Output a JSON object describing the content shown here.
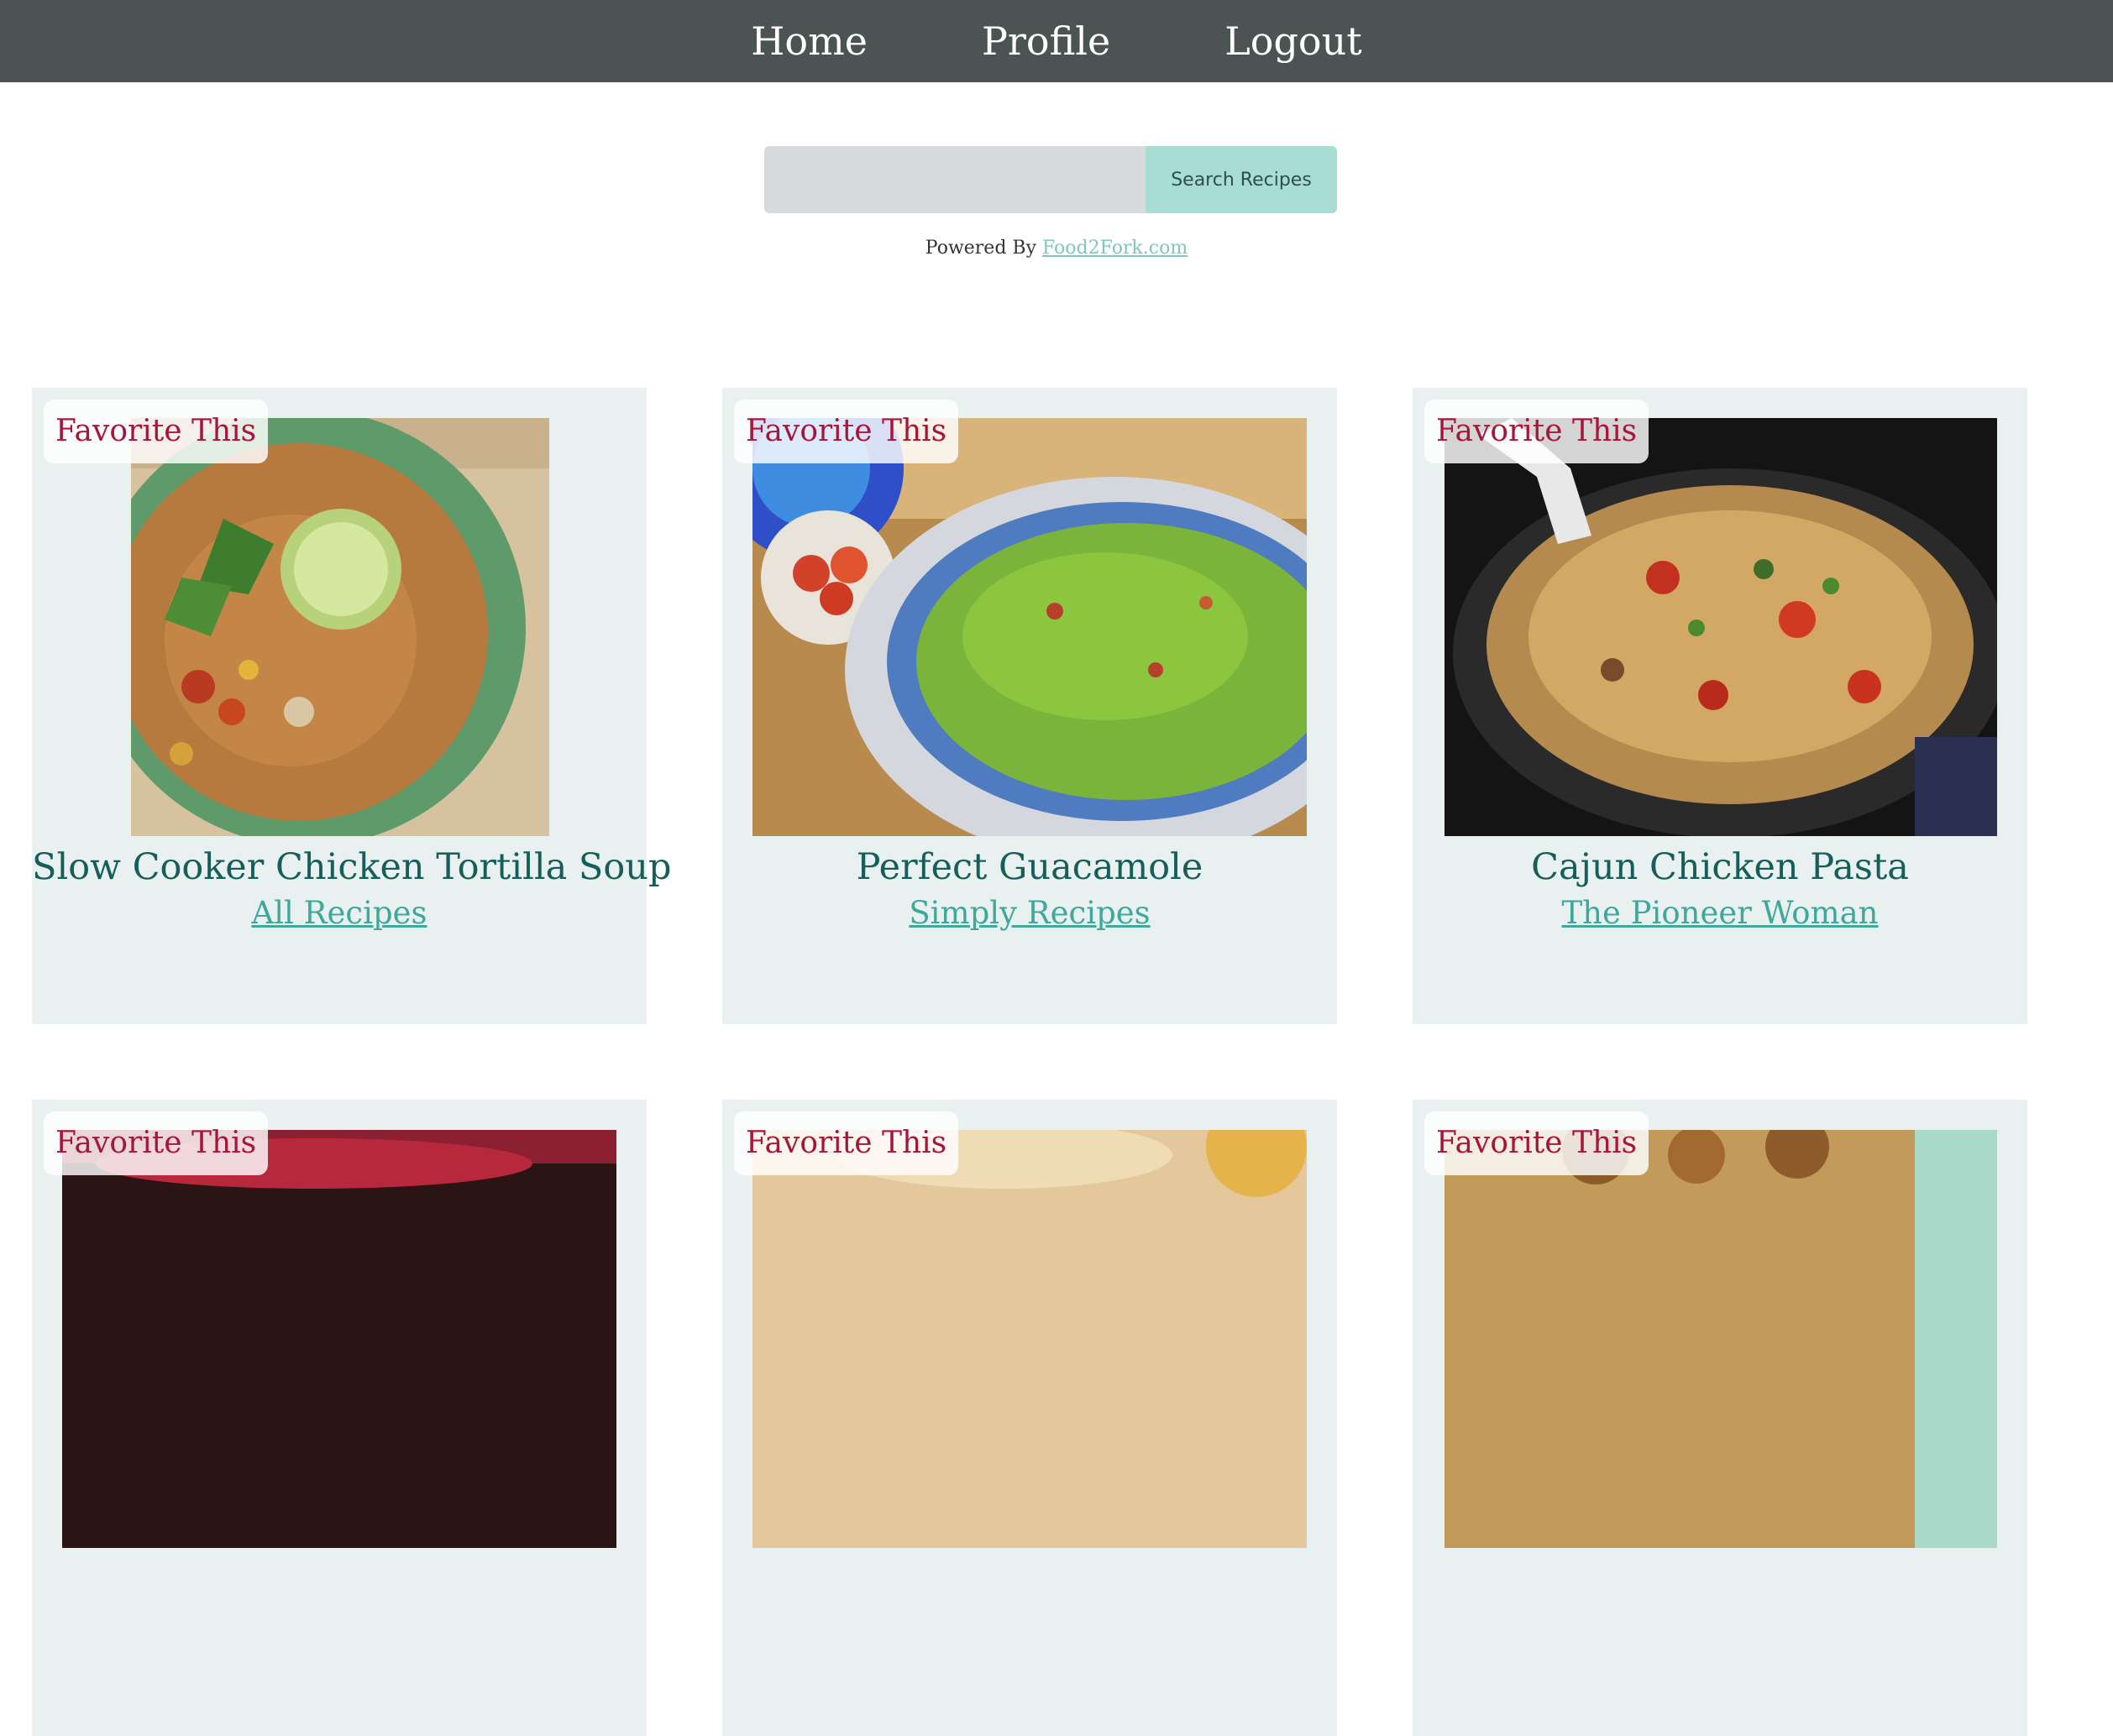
{
  "nav": {
    "home": "Home",
    "profile": "Profile",
    "logout": "Logout"
  },
  "search": {
    "value": "",
    "placeholder": "",
    "button_label": "Search Recipes"
  },
  "powered_by": {
    "prefix": "Powered By ",
    "link_text": "Food2Fork.com"
  },
  "colors": {
    "nav_background": "#4b5353",
    "card_background": "#e9f0f0",
    "favorite_text": "#a8153a",
    "title_text": "#155e59",
    "source_link": "#3ea89b",
    "search_button": "#a8ddd6"
  },
  "recipes": [
    {
      "favorite_label": "Favorite This",
      "title": "Slow Cooker Chicken Tortilla Soup",
      "source": "All Recipes",
      "image": "tortilla-soup-photo"
    },
    {
      "favorite_label": "Favorite This",
      "title": "Perfect Guacamole",
      "source": "Simply Recipes",
      "image": "guacamole-photo"
    },
    {
      "favorite_label": "Favorite This",
      "title": "Cajun Chicken Pasta",
      "source": "The Pioneer Woman",
      "image": "cajun-pasta-photo"
    },
    {
      "favorite_label": "Favorite This",
      "title": "",
      "source": "",
      "image": "recipe-photo-4"
    },
    {
      "favorite_label": "Favorite This",
      "title": "",
      "source": "",
      "image": "recipe-photo-5"
    },
    {
      "favorite_label": "Favorite This",
      "title": "",
      "source": "",
      "image": "recipe-photo-6"
    }
  ]
}
